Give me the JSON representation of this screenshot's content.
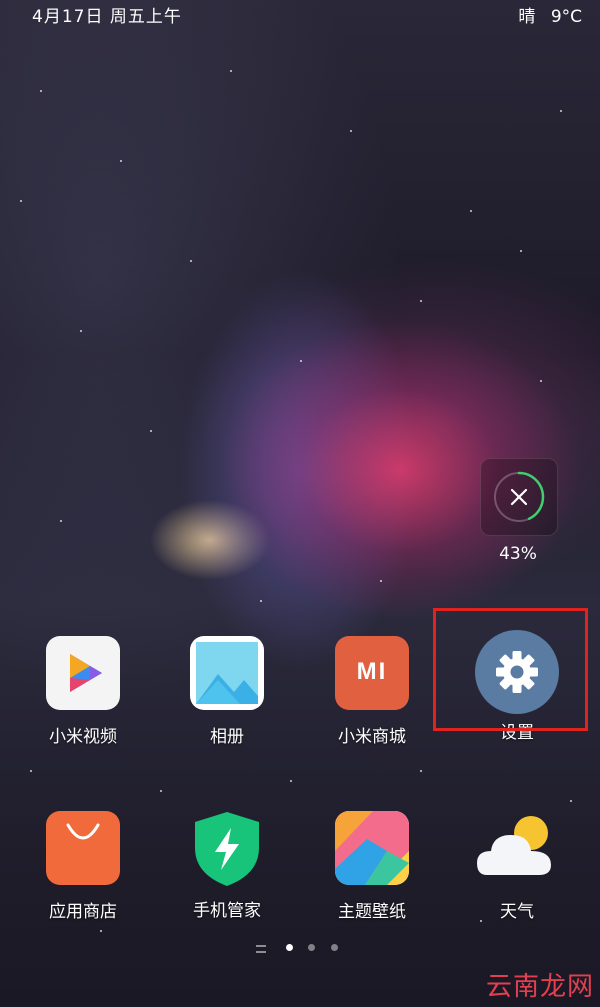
{
  "status_bar": {
    "date_time": "4月17日 周五上午",
    "weather": "晴",
    "temperature": "9°C"
  },
  "cleaner_widget": {
    "percent": "43%",
    "progress": 0.43,
    "icon": "close-icon"
  },
  "apps_row1": [
    {
      "label": "小米视频",
      "icon": "video-icon"
    },
    {
      "label": "相册",
      "icon": "gallery-icon"
    },
    {
      "label": "小米商城",
      "icon": "mi-store-icon",
      "logo_text": "MI"
    },
    {
      "label": "设置",
      "icon": "settings-gear-icon"
    }
  ],
  "apps_row2": [
    {
      "label": "应用商店",
      "icon": "app-store-icon"
    },
    {
      "label": "手机管家",
      "icon": "security-icon"
    },
    {
      "label": "主题壁纸",
      "icon": "themes-icon"
    },
    {
      "label": "天气",
      "icon": "weather-icon"
    }
  ],
  "page_indicator": {
    "pages": 3,
    "active_index": 0
  },
  "colors": {
    "highlight_box": "#e0231e",
    "settings_icon_bg": "#5a7ba2",
    "mi_store_bg": "#e06040",
    "app_store_bg": "#f06a3c",
    "security_bg": "#18c37a"
  },
  "watermark": "云南龙网"
}
